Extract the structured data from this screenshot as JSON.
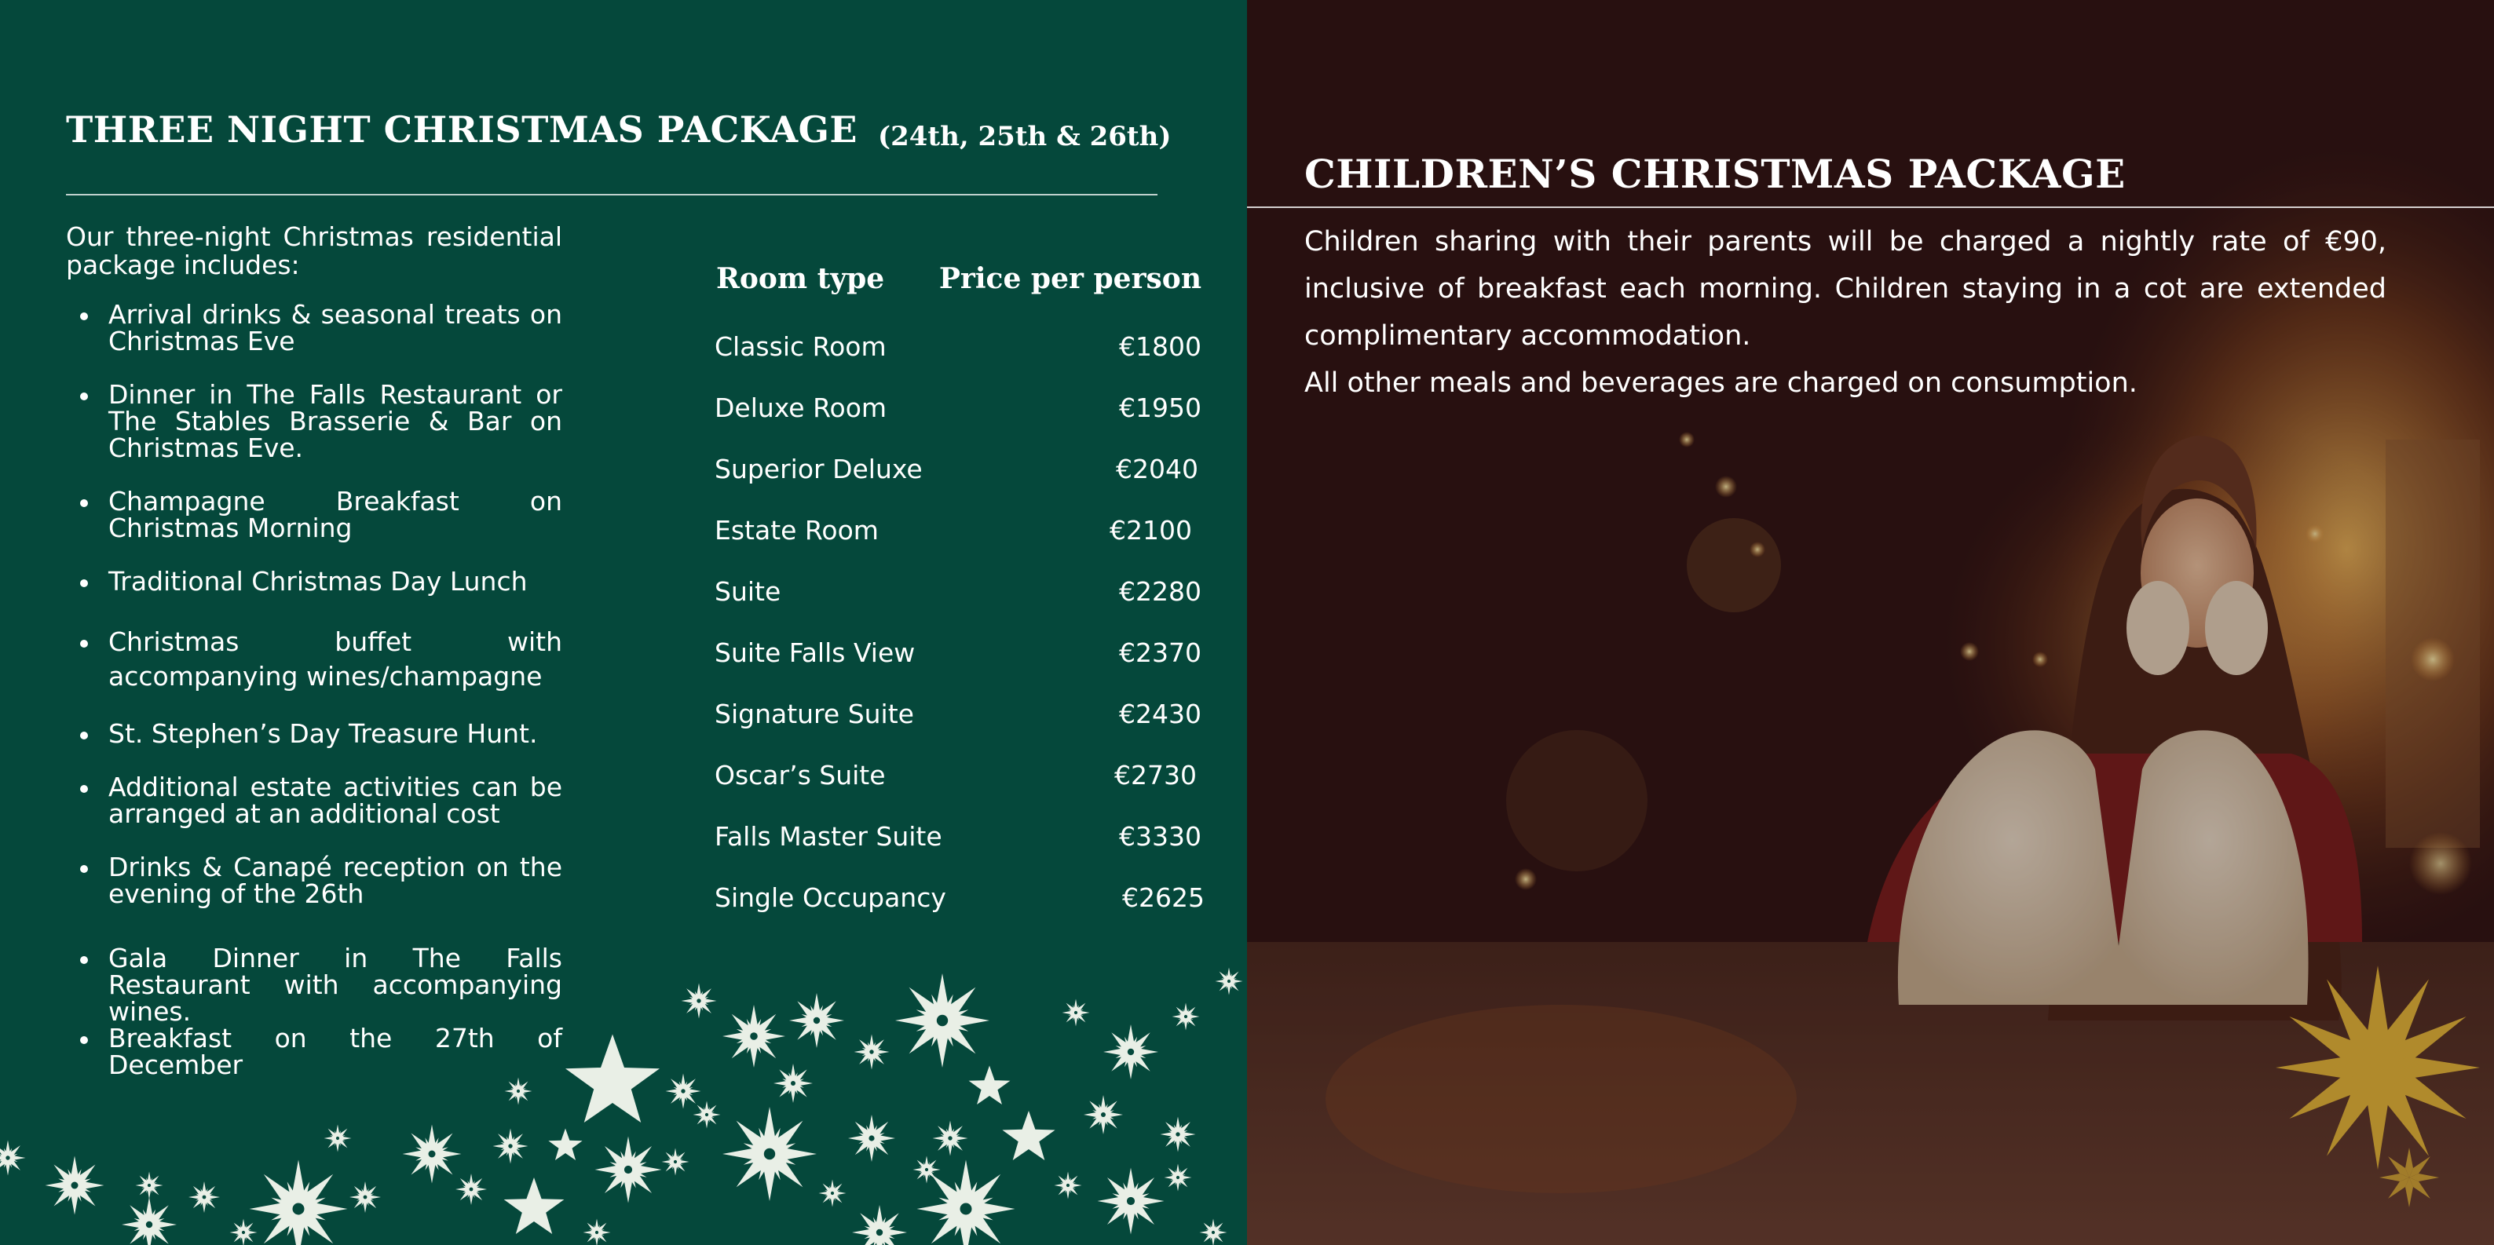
{
  "left": {
    "title": "THREE NIGHT CHRISTMAS PACKAGE",
    "dates": "(24th, 25th & 26th)",
    "intro": "Our three-night Christmas residential package includes:",
    "includes": [
      "Arrival drinks & seasonal treats on Christmas Eve",
      "Dinner in The Falls Restaurant or The Stables Brasserie & Bar on Christmas Eve.",
      "Champagne Breakfast on Christmas Morning",
      "Traditional Christmas Day Lunch",
      "Christmas buffet with accompanying wines/champagne",
      "St. Stephen’s Day Treasure Hunt.",
      "Additional estate activities can be arranged at an additional cost",
      "Drinks & Canapé reception on the evening of the 26th",
      "Gala Dinner in The Falls Restaurant with accompanying wines.",
      "Breakfast on the 27th of December"
    ]
  },
  "rooms": {
    "header_room": "Room type",
    "header_price": "Price per person",
    "rows": [
      {
        "name": "Classic Room",
        "price": "€1800"
      },
      {
        "name": "Deluxe Room",
        "price": "€1950"
      },
      {
        "name": "Superior Deluxe",
        "price": "€2040"
      },
      {
        "name": "Estate Room",
        "price": "€2100"
      },
      {
        "name": "Suite",
        "price": "€2280"
      },
      {
        "name": "Suite Falls View",
        "price": "€2370"
      },
      {
        "name": "Signature Suite",
        "price": "€2430"
      },
      {
        "name": "Oscar’s Suite",
        "price": "€2730"
      },
      {
        "name": "Falls Master Suite",
        "price": "€3330"
      },
      {
        "name": "Single Occupancy",
        "price": "€2625"
      }
    ]
  },
  "right": {
    "title": "CHILDREN’S CHRISTMAS PACKAGE",
    "body": "Children sharing with their parents will be charged a nightly rate of €90, inclusive of breakfast each morning. Children staying in a cot are extended complimentary accommodation.",
    "meals": "All other meals and beverages are charged on consumption."
  },
  "colors": {
    "background_green": "#05483b",
    "text": "#ffffff",
    "snowflake": "#e9efe6",
    "gold_star": "#b08a2c"
  },
  "icons": [
    "snowflake-icon",
    "gold-star-icon"
  ]
}
